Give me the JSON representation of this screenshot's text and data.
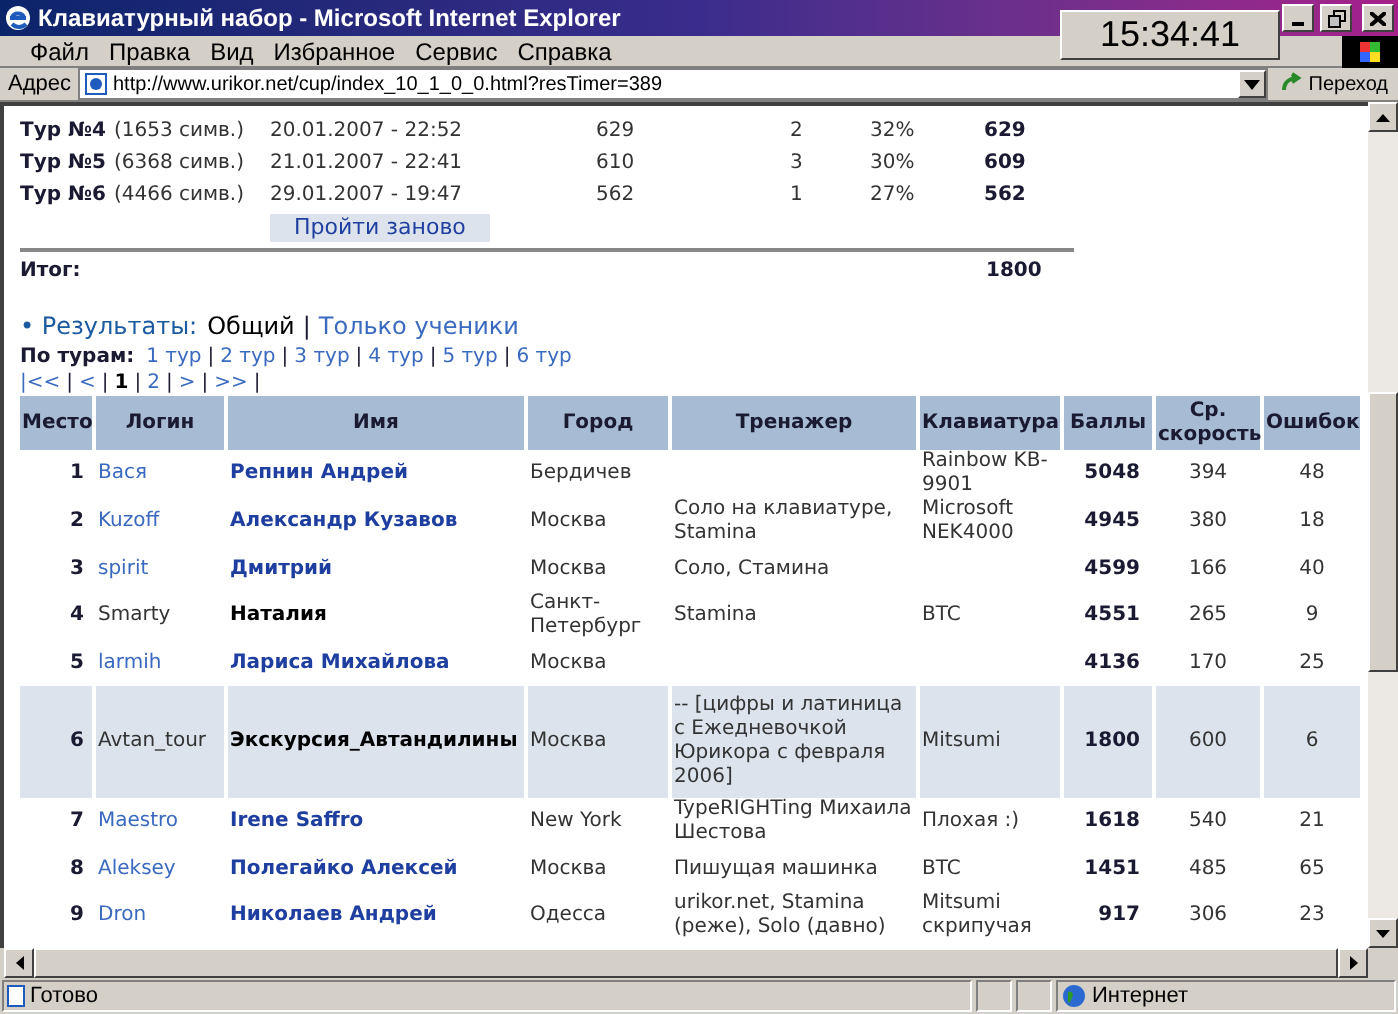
{
  "window": {
    "title": "Клавиатурный набор - Microsoft Internet Explorer",
    "clock": "15:34:41"
  },
  "menu": [
    "Файл",
    "Правка",
    "Вид",
    "Избранное",
    "Сервис",
    "Справка"
  ],
  "address": {
    "label": "Адрес",
    "url": "http://www.urikor.net/cup/index_10_1_0_0.html?resTimer=389",
    "go": "Переход"
  },
  "tours": [
    {
      "name": "Тур №4",
      "chars": "(1653 симв.)",
      "date": "20.01.2007 - 22:52",
      "column_3": "629",
      "column_4": "2",
      "column_5": "32%",
      "score": "629"
    },
    {
      "name": "Тур №5",
      "chars": "(6368 симв.)",
      "date": "21.01.2007 - 22:41",
      "column_3": "610",
      "column_4": "3",
      "column_5": "30%",
      "score": "609"
    },
    {
      "name": "Тур №6",
      "chars": "(4466 симв.)",
      "date": "29.01.2007 - 19:47",
      "column_3": "562",
      "column_4": "1",
      "column_5": "27%",
      "score": "562"
    }
  ],
  "retry_button": "Пройти заново",
  "total": {
    "label": "Итог:",
    "value": "1800"
  },
  "results": {
    "title": "• Результаты:",
    "separator": "|",
    "filters": [
      {
        "label": "Общий",
        "selected": true
      },
      {
        "label": "Только ученики",
        "selected": false
      }
    ],
    "by_tour_label": "По турам:",
    "tour_links": [
      "1 тур",
      "2 тур",
      "3 тур",
      "4 тур",
      "5 тур",
      "6 тур"
    ],
    "pager": [
      {
        "label": "|<<",
        "selected": false
      },
      {
        "label": "<",
        "selected": false
      },
      {
        "label": "1",
        "selected": true
      },
      {
        "label": "2",
        "selected": false
      },
      {
        "label": ">",
        "selected": false
      },
      {
        "label": ">>",
        "selected": false
      }
    ]
  },
  "table": {
    "columns": [
      "Место",
      "Логин",
      "Имя",
      "Город",
      "Тренажер",
      "Клавиатура",
      "Баллы",
      "Ср. скорость",
      "Ошибок"
    ],
    "rows": [
      {
        "cells": [
          "1",
          "Вася",
          "Репнин Андрей",
          "Бердичев",
          "",
          "Rainbow KB-9901",
          "5048",
          "394",
          "48"
        ],
        "linked": true,
        "highlighted": false
      },
      {
        "cells": [
          "2",
          "Kuzoff",
          "Александр Кузавов",
          "Москва",
          "Соло на клавиатуре, Stamina",
          "Microsoft NEK4000",
          "4945",
          "380",
          "18"
        ],
        "linked": true,
        "highlighted": false
      },
      {
        "cells": [
          "3",
          "spirit",
          "Дмитрий",
          "Москва",
          "Соло, Стамина",
          "",
          "4599",
          "166",
          "40"
        ],
        "linked": true,
        "highlighted": false
      },
      {
        "cells": [
          "4",
          "Smarty",
          "Наталия",
          "Санкт-Петербург",
          "Stamina",
          "BTC",
          "4551",
          "265",
          "9"
        ],
        "linked": false,
        "highlighted": false
      },
      {
        "cells": [
          "5",
          "larmih",
          "Лариса Михайлова",
          "Москва",
          "",
          "",
          "4136",
          "170",
          "25"
        ],
        "linked": true,
        "highlighted": false
      },
      {
        "cells": [
          "6",
          "Avtan_tour",
          "Экскурсия_Автандилины",
          "Москва",
          "-- [цифры и латиница с Ежедневочкой Юрикора с февраля 2006]",
          "Mitsumi",
          "1800",
          "600",
          "6"
        ],
        "linked": false,
        "highlighted": true
      },
      {
        "cells": [
          "7",
          "Maestro",
          "Irene Saffro",
          "New York",
          "TypeRIGHTing Михаила Шестова",
          "Плохая :)",
          "1618",
          "540",
          "21"
        ],
        "linked": true,
        "highlighted": false
      },
      {
        "cells": [
          "8",
          "Aleksey",
          "Полегайко Алексей",
          "Москва",
          "Пишущая машинка",
          "BTC",
          "1451",
          "485",
          "65"
        ],
        "linked": true,
        "highlighted": false
      },
      {
        "cells": [
          "9",
          "Dron",
          "Николаев Андрей",
          "Одесса",
          "urikor.net, Stamina (реже), Solo (давно)",
          "Mitsumi скрипучая",
          "917",
          "306",
          "23"
        ],
        "linked": true,
        "highlighted": false
      }
    ]
  },
  "status_bar": {
    "text": "Готово",
    "zone": "Интернет"
  }
}
